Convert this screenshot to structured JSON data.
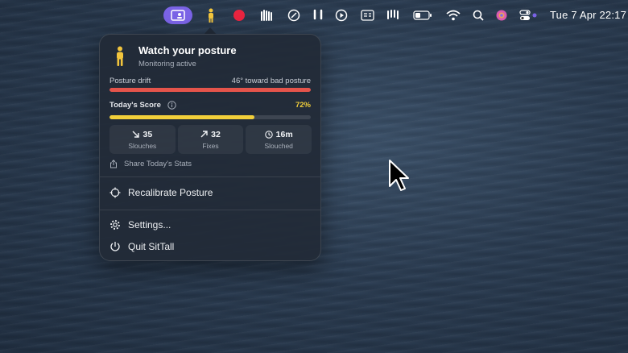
{
  "menubar": {
    "datetime": "Tue 7 Apr  22:17",
    "icons": [
      "sittall-active-icon",
      "posture-person-icon",
      "record-icon",
      "hands-icon",
      "compass-icon",
      "airpods-icon",
      "play-icon",
      "display-icon",
      "airpods-icon-2",
      "battery-icon",
      "wifi-icon",
      "search-icon",
      "siri-icon",
      "control-center-icon"
    ]
  },
  "popover": {
    "title": "Watch your posture",
    "subtitle": "Monitoring active",
    "drift": {
      "label": "Posture drift",
      "value": "46° toward bad posture",
      "level": 1.0,
      "color": "#e5544b"
    },
    "score": {
      "label": "Today's Score",
      "value": "72%",
      "level": 0.72,
      "color": "#f2cf3a"
    },
    "stats": [
      {
        "value": "35",
        "label": "Slouches",
        "icon": "arrow-down-right-icon"
      },
      {
        "value": "32",
        "label": "Fixes",
        "icon": "arrow-up-right-icon"
      },
      {
        "value": "16m",
        "label": "Slouched",
        "icon": "clock-icon"
      }
    ],
    "share_label": "Share Today's Stats",
    "menu": {
      "recalibrate": "Recalibrate Posture",
      "settings": "Settings...",
      "quit": "Quit SitTall"
    }
  },
  "colors": {
    "accent": "#7a63e6",
    "person": "#f2c53d",
    "record": "#e8243f"
  }
}
